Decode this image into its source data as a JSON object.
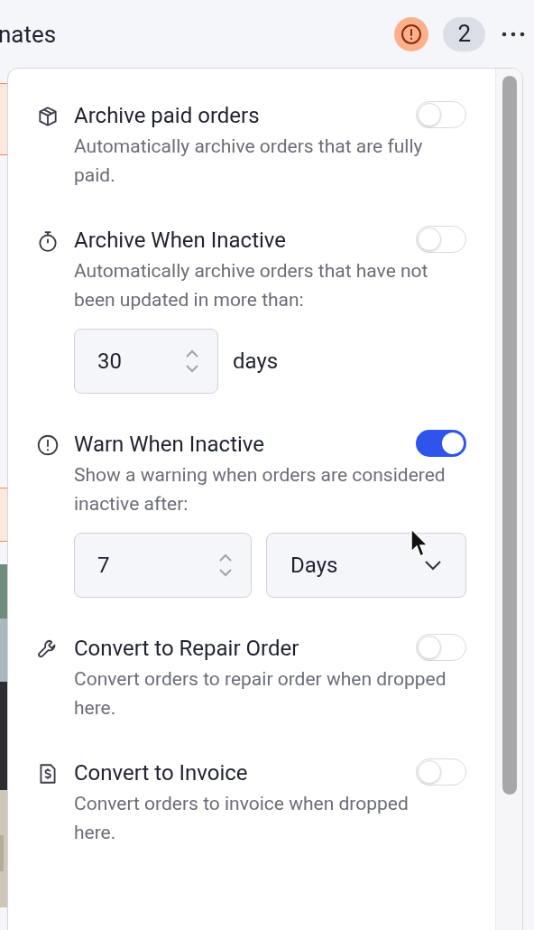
{
  "header": {
    "title": "nates",
    "count": "2"
  },
  "settings": [
    {
      "title": "Archive paid orders",
      "description": "Automatically archive orders that are fully paid.",
      "on": false
    },
    {
      "title": "Archive When Inactive",
      "description": "Automatically archive orders that have not been updated in more than:",
      "on": false,
      "inputs": [
        {
          "kind": "number",
          "value": "30"
        },
        {
          "kind": "unit",
          "text": "days"
        }
      ]
    },
    {
      "title": "Warn When Inactive",
      "description": "Show a warning when orders are considered inactive after:",
      "on": true,
      "inputs": [
        {
          "kind": "number",
          "value": "7"
        },
        {
          "kind": "select",
          "value": "Days"
        }
      ]
    },
    {
      "title": "Convert to Repair Order",
      "description": "Convert orders to repair order when dropped here.",
      "on": false
    },
    {
      "title": "Convert to Invoice",
      "description": "Convert orders to invoice when dropped here.",
      "on": false
    }
  ]
}
